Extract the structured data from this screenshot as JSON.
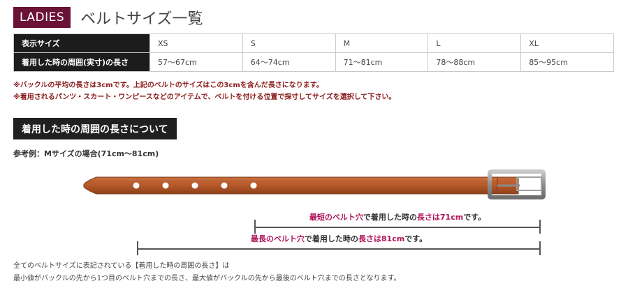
{
  "header": {
    "badge": "LADIES",
    "title": "ベルトサイズ一覧"
  },
  "size_table": {
    "row_headers": [
      "表示サイズ",
      "着用した時の周囲(実寸)の長さ"
    ],
    "sizes": [
      "XS",
      "S",
      "M",
      "L",
      "XL"
    ],
    "lengths": [
      "57～67cm",
      "64～74cm",
      "71～81cm",
      "78～88cm",
      "85～95cm"
    ]
  },
  "notes": [
    "※バックルの平均の長さは3cmです。上記のベルトのサイズはこの3cmを含んだ長さになります。",
    "※着用されるパンツ・スカート・ワンピースなどのアイテムで、ベルトを付ける位置で採寸してサイズを選択して下さい。"
  ],
  "section": {
    "heading": "着用した時の周囲の長さについて",
    "example": "参考例：Mサイズの場合(71cm～81cm)"
  },
  "measurements": {
    "shortest": {
      "hl1": "最短のベルト穴",
      "mid": "で着用した時の",
      "hl2": "長さは71cm",
      "end": "です。"
    },
    "longest": {
      "hl1": "最長のベルト穴",
      "mid": "で着用した時の",
      "hl2": "長さは81cm",
      "end": "です。"
    }
  },
  "footer": [
    "全てのベルトサイズに表記されている【着用した時の周囲の長さ】は",
    "最小値がバックルの先から1つ目のベルト穴までの長さ、最大値がバックルの先から最後のベルト穴までの長さとなります。"
  ],
  "colors": {
    "badge": "#6b1239",
    "note_text": "#8b1a1a",
    "highlight": "#b0145a",
    "belt_leather": "#b5582a",
    "buckle": "#9a9a9a"
  },
  "belt": {
    "hole_count": 5
  }
}
